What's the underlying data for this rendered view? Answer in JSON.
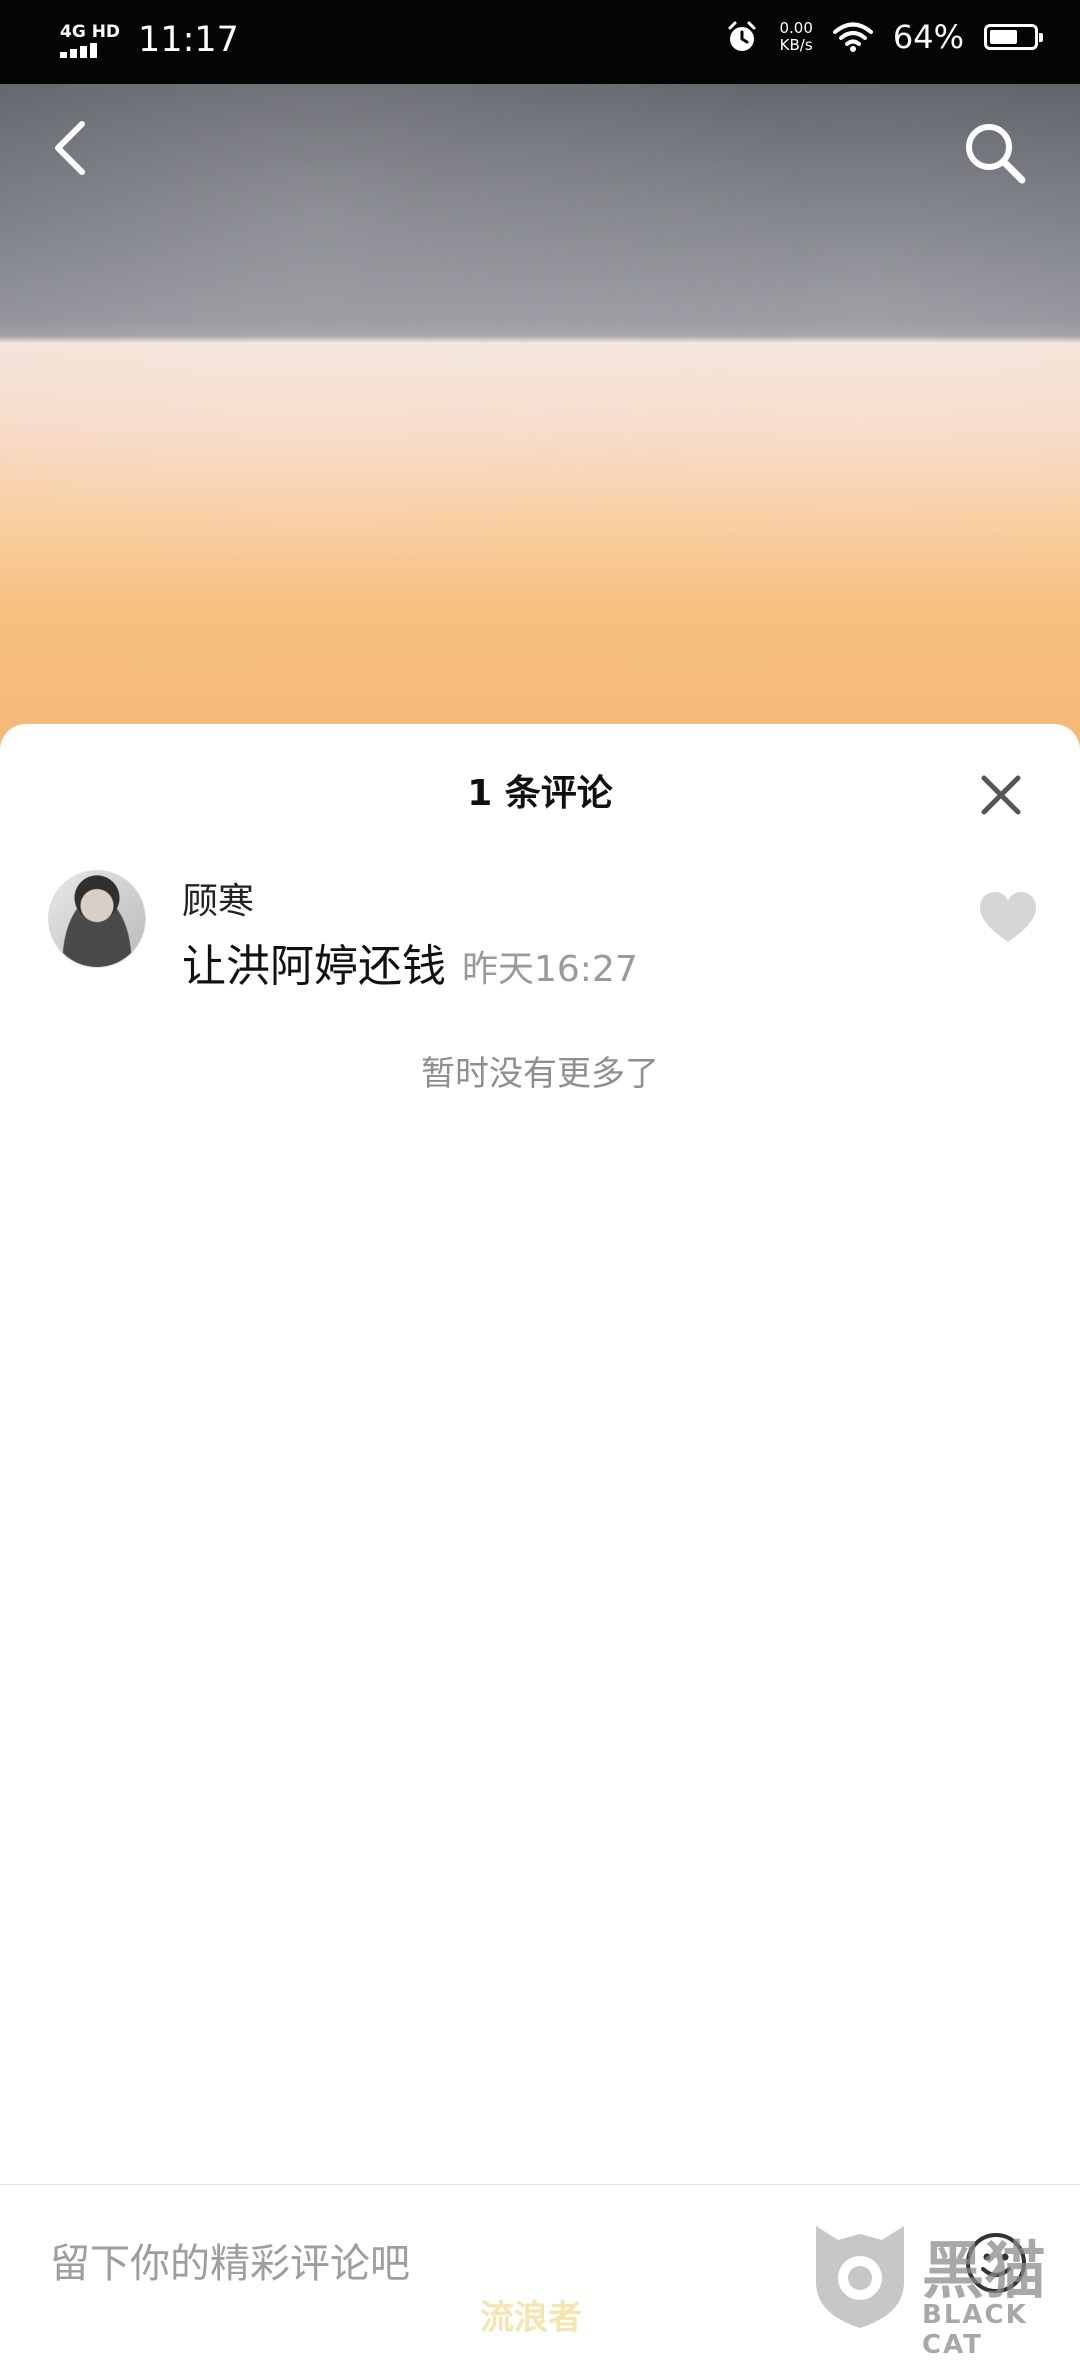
{
  "status_bar": {
    "network": "4G HD",
    "time": "11:17",
    "speed_value": "0.00",
    "speed_unit": "KB/s",
    "battery_percent": "64%",
    "battery_level": 0.64
  },
  "header": {
    "back_icon": "chevron-left-icon",
    "search_icon": "search-icon"
  },
  "comments_sheet": {
    "title": "1 条评论",
    "close_icon": "close-icon",
    "comments": [
      {
        "user": "顾寒",
        "text": "让洪阿婷还钱",
        "time": "昨天16:27",
        "like_icon": "heart-icon"
      }
    ],
    "no_more": "暂时没有更多了"
  },
  "input_bar": {
    "placeholder": "留下你的精彩评论吧",
    "emoji_icon": "smiley-icon"
  },
  "watermark": {
    "left_text": "流浪者",
    "brand_cn": "黑猫",
    "brand_en": "BLACK CAT"
  }
}
